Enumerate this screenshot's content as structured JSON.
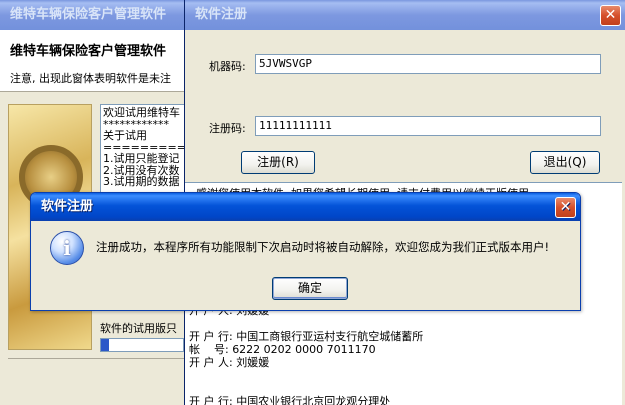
{
  "main_window": {
    "title": "维特车辆保险客户管理软件",
    "heading": "维特车辆保险客户管理软件",
    "subtitle": "注意, 出现此窗体表明软件是未注",
    "info_lines": [
      "欢迎试用维特车",
      "************",
      "关于试用",
      "==========",
      "1.试用只能登记",
      "2.试用没有次数",
      "3.试用期的数据"
    ],
    "trial_label": "软件的试用版只",
    "trial_progress": 0.1
  },
  "reg_window": {
    "title": "软件注册",
    "machine_code_label": "机器码:",
    "machine_code_value": "5JVWSVGP",
    "reg_code_label": "注册码:",
    "reg_code_value": "11111111111",
    "register_button": "注册(R)",
    "exit_button": "退出(Q)",
    "textarea_lines": [
      "  感谢您使用本软件, 如果您希望长期使用, 请支付费用以继续正版使用",
      "",
      "",
      "",
      "",
      "",
      "",
      "",
      "",
      "开 户 人: 刘媛媛",
      "",
      "开 户 行: 中国工商银行亚运村支行航空城储蓄所",
      "帐    号: 6222 0202 0000 7011170",
      "开 户 人: 刘媛媛",
      "",
      "",
      "开 户 行: 中国农业银行北京回龙观分理处"
    ]
  },
  "message_dialog": {
    "title": "软件注册",
    "message": "注册成功，本程序所有功能限制下次启动时将被自动解除，欢迎您成为我们正式版本用户!",
    "ok_button": "确定",
    "icon": "info-icon"
  },
  "colors": {
    "titlebar_active": "#0453d8",
    "window_bg": "#ece9d8",
    "close_button": "#d5502b"
  }
}
